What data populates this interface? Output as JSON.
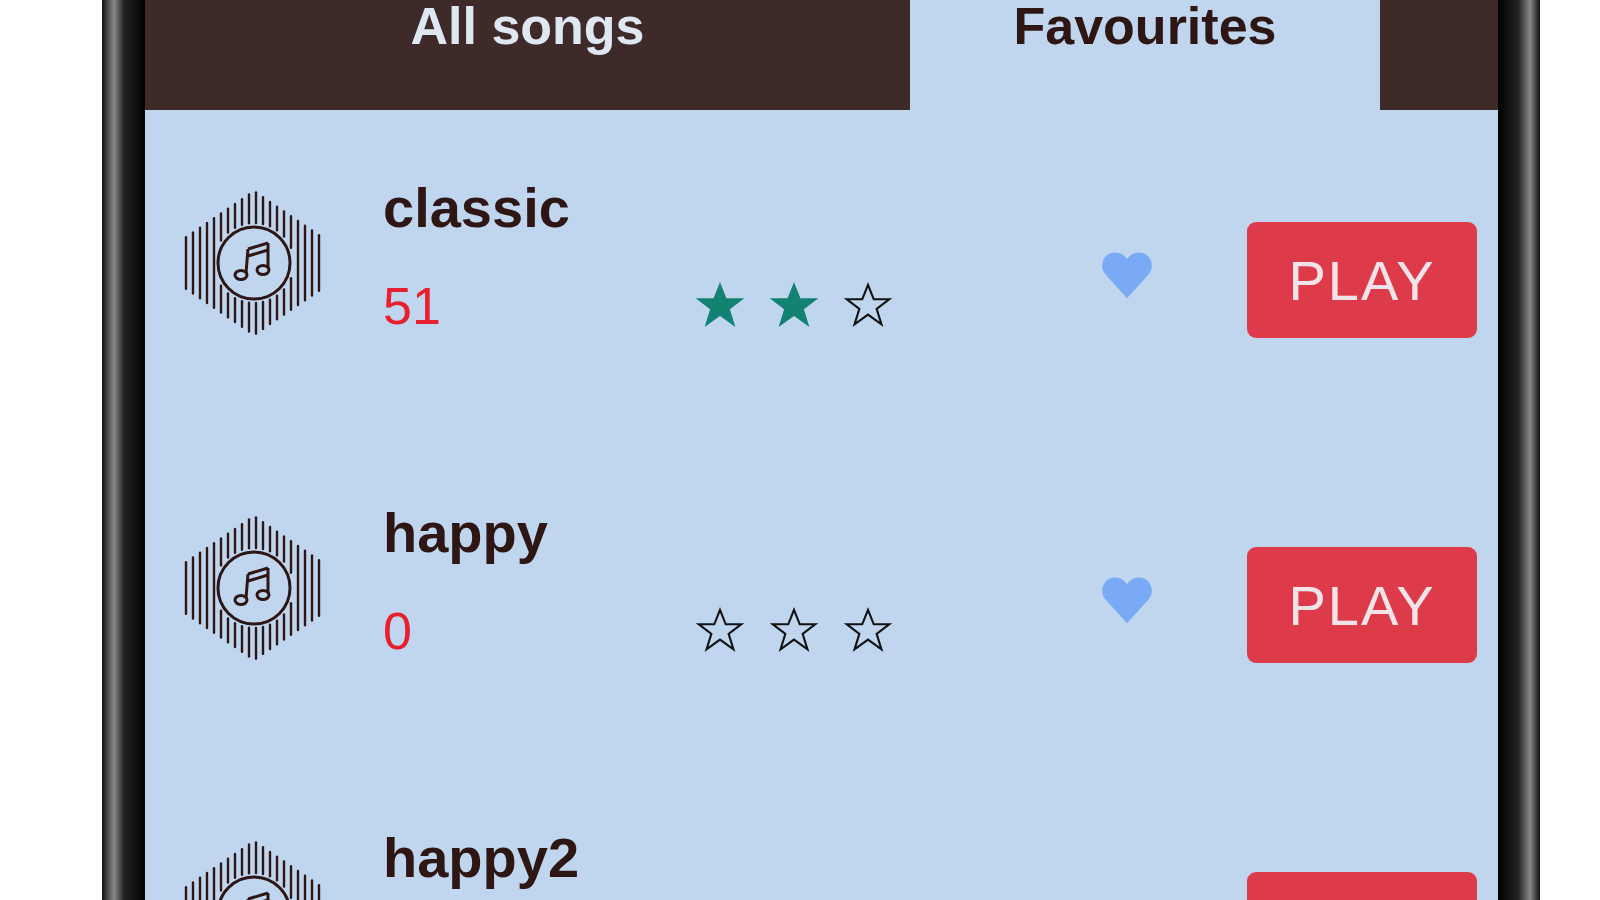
{
  "tabs": [
    {
      "label": "All songs",
      "selected": false
    },
    {
      "label": "Favourites",
      "selected": true
    }
  ],
  "songs": [
    {
      "title": "classic",
      "count": "51",
      "stars": 2,
      "favourite": true,
      "button": "PLAY"
    },
    {
      "title": "happy",
      "count": "0",
      "stars": 0,
      "favourite": true,
      "button": "PLAY"
    },
    {
      "title": "happy2"
    }
  ]
}
